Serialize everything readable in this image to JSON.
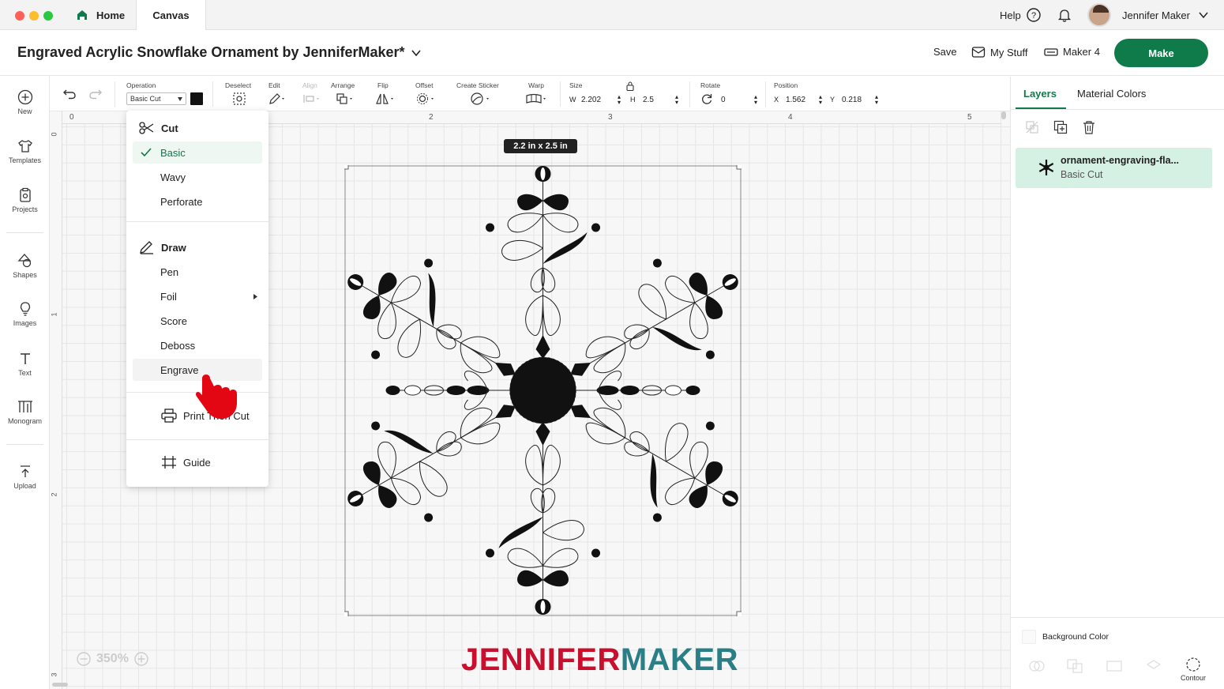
{
  "window": {
    "tabs": [
      {
        "label": "Home"
      },
      {
        "label": "Canvas"
      }
    ],
    "help_label": "Help",
    "user_name": "Jennifer Maker"
  },
  "header": {
    "title": "Engraved Acrylic Snowflake Ornament by JenniferMaker*",
    "save_label": "Save",
    "my_stuff_label": "My Stuff",
    "machine_label": "Maker 4",
    "make_label": "Make"
  },
  "sidebar": {
    "items": [
      {
        "label": "New"
      },
      {
        "label": "Templates"
      },
      {
        "label": "Projects"
      },
      {
        "label": "Shapes"
      },
      {
        "label": "Images"
      },
      {
        "label": "Text"
      },
      {
        "label": "Monogram"
      },
      {
        "label": "Upload"
      }
    ]
  },
  "toolbar": {
    "operation_label": "Operation",
    "operation_value": "Basic Cut",
    "deselect_label": "Deselect",
    "edit_label": "Edit",
    "align_label": "Align",
    "arrange_label": "Arrange",
    "flip_label": "Flip",
    "offset_label": "Offset",
    "create_sticker_label": "Create Sticker",
    "warp_label": "Warp",
    "size_label": "Size",
    "w_label": "W",
    "w_value": "2.202",
    "h_label": "H",
    "h_value": "2.5",
    "rotate_label": "Rotate",
    "rotate_value": "0",
    "position_label": "Position",
    "x_label": "X",
    "x_value": "1.562",
    "y_label": "Y",
    "y_value": "0.218"
  },
  "canvas": {
    "ruler_top": [
      "0",
      "2",
      "3",
      "4",
      "5"
    ],
    "ruler_left": [
      "0",
      "1",
      "2",
      "3"
    ],
    "size_badge": "2.2  in x 2.5  in",
    "zoom_label": "350%"
  },
  "operation_menu": {
    "cut_header": "Cut",
    "cut_items": [
      "Basic",
      "Wavy",
      "Perforate"
    ],
    "draw_header": "Draw",
    "draw_items": [
      "Pen",
      "Foil",
      "Score",
      "Deboss",
      "Engrave"
    ],
    "print_then_cut": "Print Then Cut",
    "guide": "Guide",
    "selected": "Basic"
  },
  "right_panel": {
    "tabs": [
      "Layers",
      "Material Colors"
    ],
    "active_tab": "Layers",
    "layer_name": "ornament-engraving-fla...",
    "layer_operation": "Basic Cut",
    "background_color_label": "Background Color",
    "contour_label": "Contour"
  },
  "watermark": {
    "part1": "JENNIFER",
    "part2": "MAKER"
  },
  "colors": {
    "brand_green": "#0f7a4a",
    "layer_highlight": "#d4f1e4",
    "watermark_red": "#c8102e",
    "watermark_teal": "#2a7f86"
  }
}
